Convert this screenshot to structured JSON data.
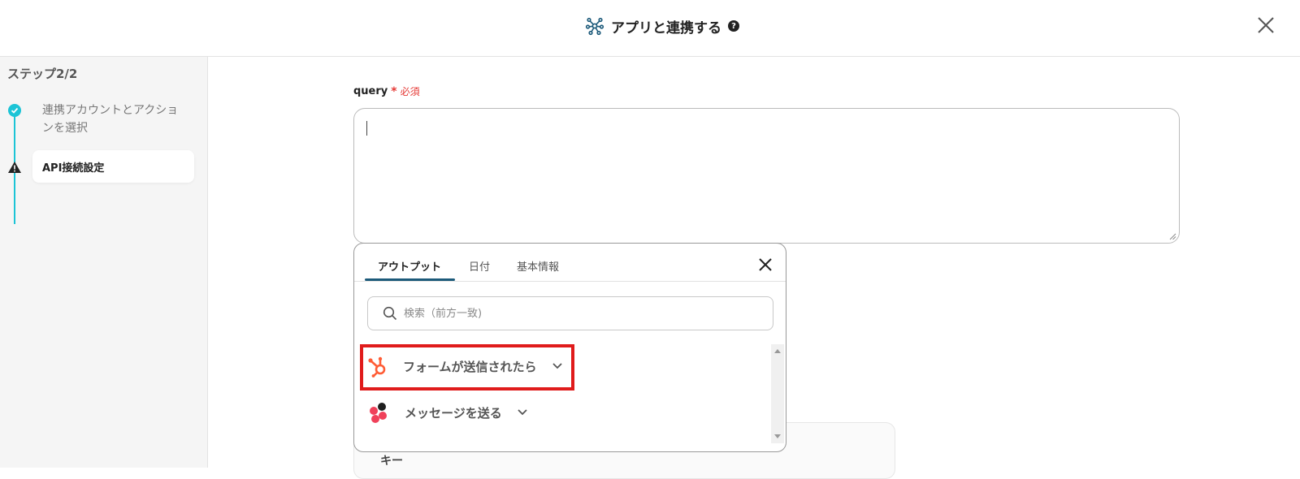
{
  "header": {
    "title": "アプリと連携する",
    "help_icon": "?",
    "icon": "network-hub-icon"
  },
  "sidebar": {
    "heading": "ステップ2/2",
    "steps": [
      {
        "label": "連携アカウントとアクションを選択",
        "status": "done"
      },
      {
        "label": "API接続設定",
        "status": "warning"
      }
    ]
  },
  "form": {
    "field_label": "query",
    "required_star": "*",
    "required_text": "必須",
    "query_value": "",
    "back_card_label": "キー"
  },
  "popup": {
    "tabs": [
      {
        "label": "アウトプット",
        "active": true
      },
      {
        "label": "日付",
        "active": false
      },
      {
        "label": "基本情報",
        "active": false
      }
    ],
    "search_placeholder": "検索（前方一致)",
    "items": [
      {
        "label": "フォームが送信されたら",
        "icon": "hubspot-icon",
        "highlighted": true
      },
      {
        "label": "メッセージを送る",
        "icon": "asana-icon",
        "highlighted": false
      }
    ]
  },
  "colors": {
    "accent": "#1cc4d6",
    "tab_underline": "#1c5a7a",
    "required": "#e53935",
    "highlight": "#e01b1b",
    "hubspot": "#ff5c35",
    "asana_dark": "#1f1f1f",
    "asana_red": "#f0415a"
  }
}
